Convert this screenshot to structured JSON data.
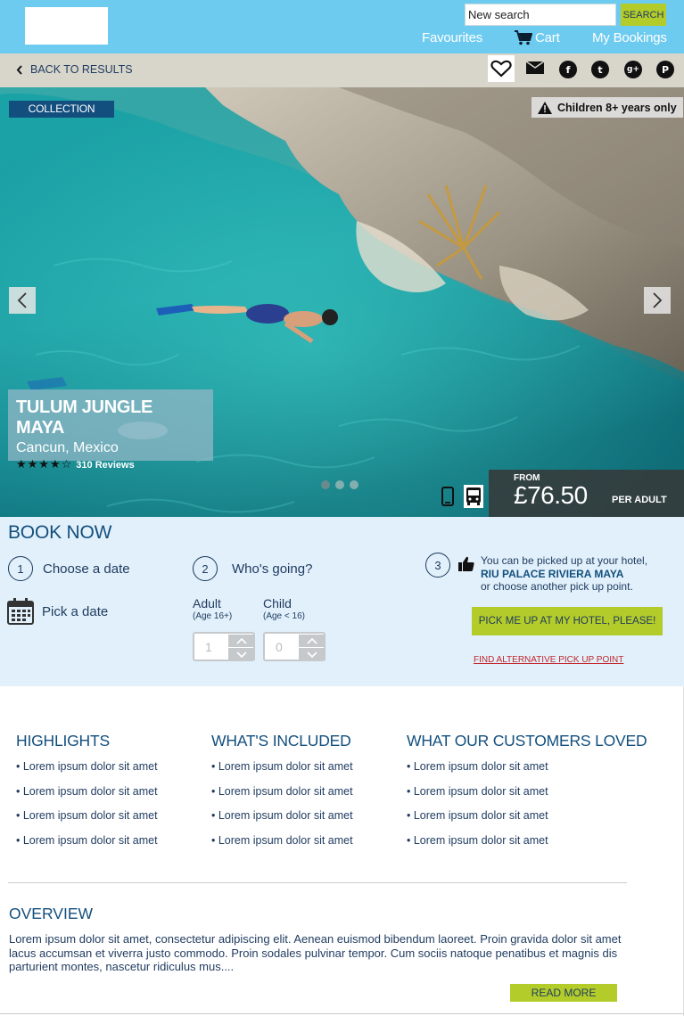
{
  "header": {
    "search_placeholder": "New search",
    "search_value": "New search",
    "search_button": "SEARCH",
    "nav": {
      "favourites": "Favourites",
      "cart": "Cart",
      "bookings": "My Bookings"
    }
  },
  "subbar": {
    "back": "BACK TO RESULTS",
    "social": {
      "facebook": "f",
      "twitter": "t",
      "googleplus": "g+",
      "pinterest": "P"
    }
  },
  "hero": {
    "badge": "COLLECTION",
    "age_notice": "Children 8+ years only",
    "title": "TULUM JUNGLE MAYA",
    "location": "Cancun, Mexico",
    "stars": "★★★★☆",
    "rating": 4,
    "reviews": "310 Reviews",
    "slides": 3,
    "active_slide": 1,
    "price": {
      "from": "FROM",
      "value": "£76.50",
      "unit": "PER ADULT"
    }
  },
  "booking": {
    "title": "BOOK NOW",
    "step1": {
      "number": "1",
      "label": "Choose a date",
      "pick": "Pick a date"
    },
    "step2": {
      "number": "2",
      "label": "Who's going?",
      "adult": {
        "label": "Adult",
        "sub": "(Age 16+)",
        "value": "1"
      },
      "child": {
        "label": "Child",
        "sub": "(Age < 16)",
        "value": "0"
      }
    },
    "step3": {
      "number": "3",
      "line1": "You can be picked up at your hotel,",
      "hotel": "RIU PALACE RIVIERA MAYA",
      "line3": "or choose another pick up point.",
      "button": "PICK ME UP AT MY HOTEL, PLEASE!",
      "alt_link": "FIND ALTERNATIVE PICK UP POINT"
    }
  },
  "sections": {
    "highlights": {
      "title": "HIGHLIGHTS",
      "items": [
        "• Lorem ipsum dolor sit amet",
        "• Lorem ipsum dolor sit amet",
        "• Lorem ipsum dolor sit amet",
        "• Lorem ipsum dolor sit amet"
      ]
    },
    "included": {
      "title": "WHAT'S INCLUDED",
      "items": [
        "• Lorem ipsum dolor sit amet",
        "• Lorem ipsum dolor sit amet",
        "• Lorem ipsum dolor sit amet",
        "• Lorem ipsum dolor sit amet"
      ]
    },
    "loved": {
      "title": "WHAT OUR CUSTOMERS LOVED",
      "items": [
        "• Lorem ipsum dolor sit amet",
        "• Lorem ipsum dolor sit amet",
        "• Lorem ipsum dolor sit amet",
        "• Lorem ipsum dolor sit amet"
      ]
    }
  },
  "overview": {
    "title": "OVERVIEW",
    "text": "Lorem ipsum dolor sit amet, consectetur adipiscing elit. Aenean euismod bibendum laoreet. Proin gravida dolor sit amet lacus accumsan et viverra justo commodo. Proin sodales pulvinar tempor. Cum sociis natoque penatibus et magnis dis parturient montes, nascetur ridiculus mus....",
    "read_more": "READ MORE"
  },
  "colors": {
    "header": "#6ecbf0",
    "accent": "#b3cc2a",
    "navy": "#134f7e",
    "book_bg": "#e1f0fa"
  },
  "icons": [
    "chevron-left-icon",
    "heart-icon",
    "mail-icon",
    "facebook-icon",
    "twitter-icon",
    "googleplus-icon",
    "pinterest-icon",
    "warning-icon",
    "phone-icon",
    "bus-icon",
    "calendar-icon",
    "thumbs-up-icon",
    "cart-icon"
  ]
}
